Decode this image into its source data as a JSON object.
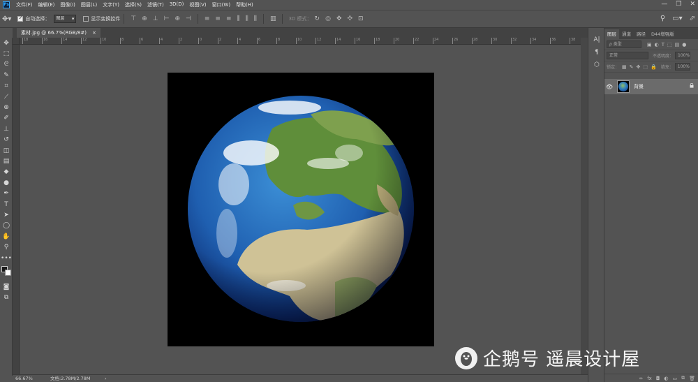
{
  "app": {
    "logo_text": "Ps"
  },
  "menu": [
    "文件(F)",
    "编辑(E)",
    "图像(I)",
    "图层(L)",
    "文字(Y)",
    "选择(S)",
    "滤镜(T)",
    "3D(D)",
    "视图(V)",
    "窗口(W)",
    "帮助(H)"
  ],
  "window_controls": {
    "minimize": "—",
    "restore": "❐",
    "close": "✕"
  },
  "options_bar": {
    "auto_select_label": "自动选择：",
    "auto_select_checked": true,
    "auto_select_value": "图层",
    "show_transform_label": "显示变换控件",
    "show_transform_checked": false,
    "mode_3d_label": "3D 模式："
  },
  "tools": [
    {
      "name": "move-tool",
      "glyph": "✥"
    },
    {
      "name": "marquee-tool",
      "glyph": "⬚"
    },
    {
      "name": "lasso-tool",
      "glyph": "ᘓ"
    },
    {
      "name": "quick-select-tool",
      "glyph": "✎"
    },
    {
      "name": "crop-tool",
      "glyph": "⌗"
    },
    {
      "name": "eyedropper-tool",
      "glyph": "⟋"
    },
    {
      "name": "healing-brush-tool",
      "glyph": "⊕"
    },
    {
      "name": "brush-tool",
      "glyph": "✐"
    },
    {
      "name": "clone-stamp-tool",
      "glyph": "⊥"
    },
    {
      "name": "history-brush-tool",
      "glyph": "↺"
    },
    {
      "name": "eraser-tool",
      "glyph": "◫"
    },
    {
      "name": "gradient-tool",
      "glyph": "▤"
    },
    {
      "name": "blur-tool",
      "glyph": "◆"
    },
    {
      "name": "dodge-tool",
      "glyph": "●"
    },
    {
      "name": "pen-tool",
      "glyph": "✒"
    },
    {
      "name": "type-tool",
      "glyph": "T"
    },
    {
      "name": "path-select-tool",
      "glyph": "➤"
    },
    {
      "name": "ellipse-tool",
      "glyph": "◯"
    },
    {
      "name": "hand-tool",
      "glyph": "✋"
    },
    {
      "name": "zoom-tool",
      "glyph": "⚲"
    },
    {
      "name": "more-tools",
      "glyph": "•••"
    }
  ],
  "document_tab": {
    "title": "素材.jpg @ 66.7%(RGB/8#)",
    "close": "×"
  },
  "ruler_numbers": [
    "18",
    "16",
    "14",
    "12",
    "10",
    "8",
    "6",
    "4",
    "2",
    "0",
    "2",
    "4",
    "6",
    "8",
    "10",
    "12",
    "14",
    "16",
    "18",
    "20",
    "22",
    "24",
    "26",
    "28",
    "30",
    "32",
    "34",
    "36",
    "38"
  ],
  "status": {
    "zoom": "66.67%",
    "doc_info": "文档:2.78M/2.78M",
    "arrow": "›"
  },
  "panel_strip": [
    "A|",
    "¶",
    "⬡"
  ],
  "layers_panel": {
    "tabs": [
      "图层",
      "通道",
      "路径",
      "D44增强版"
    ],
    "active_tab": 0,
    "filter_placeholder": "ρ 类型",
    "blend_mode": "正常",
    "opacity_label": "不透明度：",
    "opacity_value": "100%",
    "lock_label": "锁定：",
    "fill_label": "填充：",
    "fill_value": "100%",
    "layers": [
      {
        "name": "背景",
        "visible": true,
        "locked": true
      }
    ],
    "footer_icons": [
      "∞",
      "fx",
      "◘",
      "◐",
      "▭",
      "⧉",
      "🗑"
    ]
  },
  "watermark": {
    "text": "企鹅号 遥晨设计屋"
  },
  "colors": {
    "ui_bg": "#535353",
    "dark_bg": "#424242",
    "accent": "#31a8ff",
    "layer_selected": "#6b6b6b"
  }
}
